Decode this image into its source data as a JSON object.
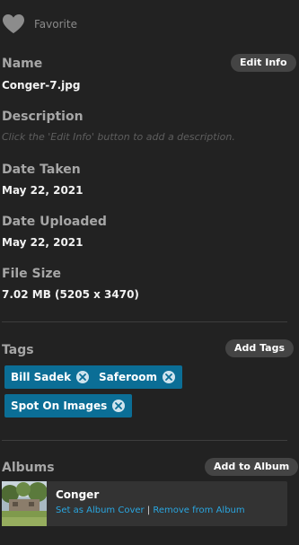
{
  "favorite": {
    "label": "Favorite",
    "icon": "heart-icon"
  },
  "name": {
    "label": "Name",
    "value": "Conger-7.jpg",
    "edit_button": "Edit Info"
  },
  "description": {
    "label": "Description",
    "placeholder": "Click the 'Edit Info' button to add a description."
  },
  "date_taken": {
    "label": "Date Taken",
    "value": "May 22, 2021"
  },
  "date_uploaded": {
    "label": "Date Uploaded",
    "value": "May 22, 2021"
  },
  "file_size": {
    "label": "File Size",
    "value": "7.02 MB (5205 x 3470)"
  },
  "tags": {
    "label": "Tags",
    "add_button": "Add Tags",
    "items": [
      {
        "label": "Bill Sadek",
        "remove_icon": "close-circle-icon"
      },
      {
        "label": "Saferoom",
        "remove_icon": "close-circle-icon"
      },
      {
        "label": "Spot On Images",
        "remove_icon": "close-circle-icon"
      }
    ]
  },
  "albums": {
    "label": "Albums",
    "add_button": "Add to Album",
    "items": [
      {
        "name": "Conger",
        "set_cover_link": "Set as Album Cover",
        "separator": "|",
        "remove_link": "Remove from Album"
      }
    ]
  },
  "colors": {
    "panel_bg": "#222222",
    "tag_bg": "#0b6e96",
    "link": "#2aa6e0",
    "button_bg": "#444444"
  }
}
